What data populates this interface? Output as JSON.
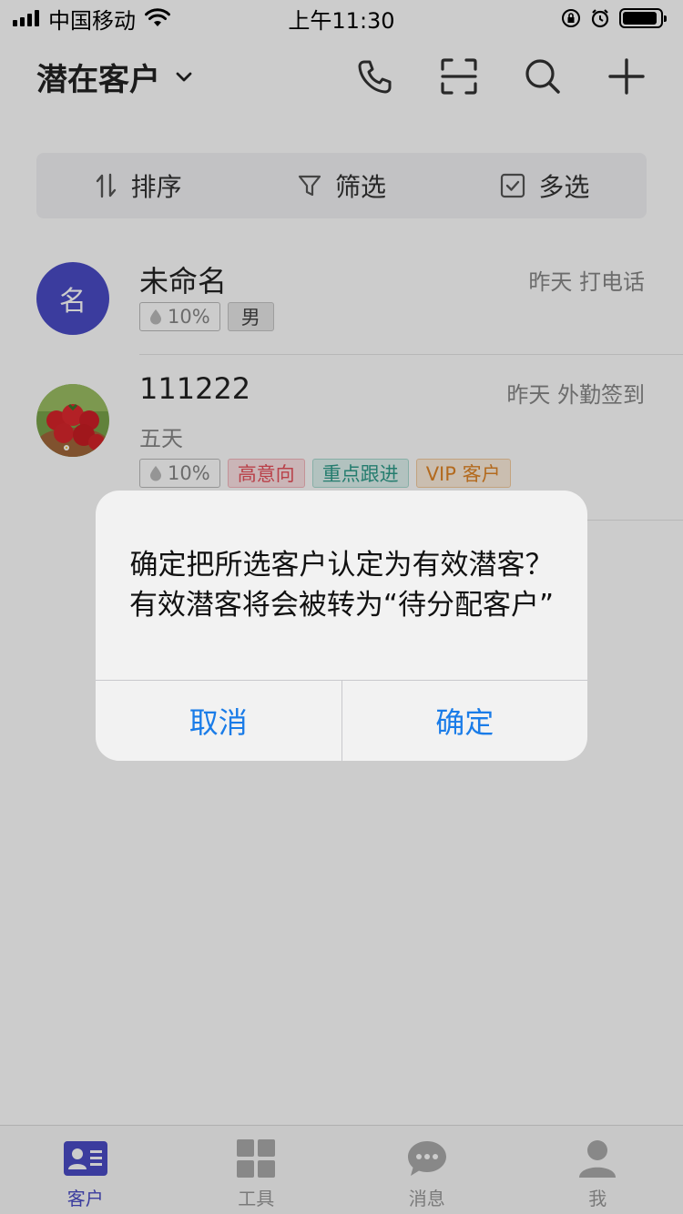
{
  "status_bar": {
    "carrier": "中国移动",
    "time": "上午11:30",
    "battery_level": 0.92
  },
  "header": {
    "title": "潜在客户",
    "icons": [
      "chevron-down-icon",
      "phone-icon",
      "scan-icon",
      "search-icon",
      "plus-icon"
    ]
  },
  "toolbar": {
    "sort_label": "排序",
    "filter_label": "筛选",
    "multiselect_label": "多选"
  },
  "customers": [
    {
      "avatar_text": "名",
      "name": "未命名",
      "meta": "昨天 打电话",
      "tags": [
        "10%",
        "男"
      ]
    },
    {
      "avatar": "strawberry-photo",
      "name": "111222",
      "meta": "昨天 外勤签到",
      "subtitle": "五天",
      "tags": [
        "10%",
        "高意向",
        "重点跟进",
        "VIP 客户"
      ]
    }
  ],
  "dialog": {
    "message": "确定把所选客户认定为有效潜客？有效潜客将会被转为“待分配客户”",
    "cancel_label": "取消",
    "confirm_label": "确定"
  },
  "tabbar": {
    "tabs": [
      {
        "label": "客户",
        "icon": "contact-card-icon",
        "active": true
      },
      {
        "label": "工具",
        "icon": "grid-icon",
        "active": false
      },
      {
        "label": "消息",
        "icon": "chat-bubble-icon",
        "active": false
      },
      {
        "label": "我",
        "icon": "person-icon",
        "active": false
      }
    ]
  },
  "colors": {
    "accent": "#4a4bc6",
    "dialog_button": "#1a7ce8",
    "tag_high": "#e8505b",
    "tag_key": "#2e9c8a",
    "tag_vip": "#e08526"
  }
}
